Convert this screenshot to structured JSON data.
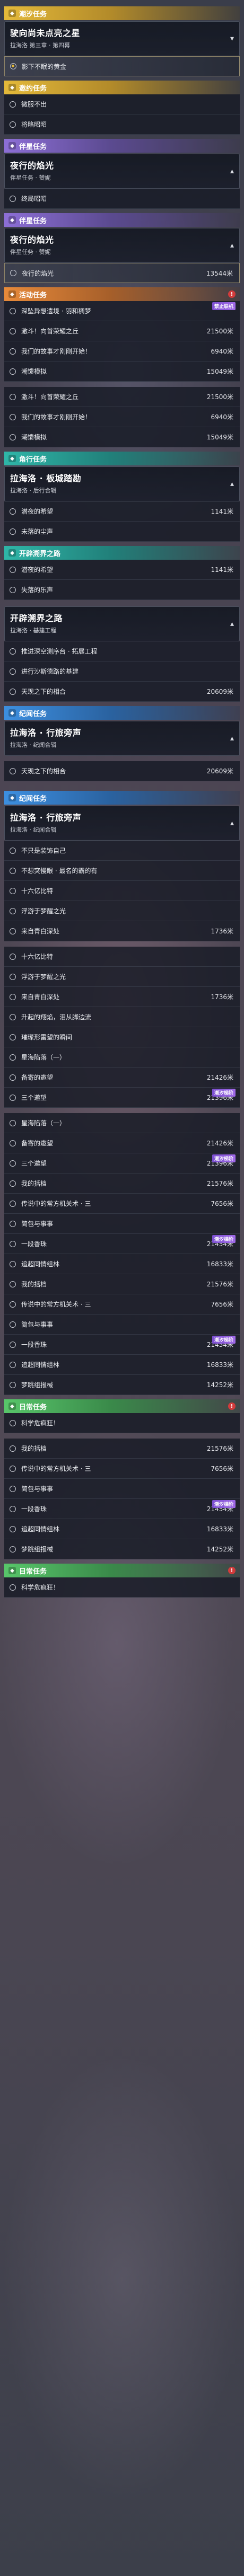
{
  "icons": {
    "bullet": "circle-bullet-icon",
    "expand": "chevron-icon",
    "section": "quest-type-icon",
    "alert": "alert-dot-icon"
  },
  "blocks": [
    {
      "type": "section",
      "color": "yellow",
      "label": "潮汐任务",
      "alert": false
    },
    {
      "type": "card",
      "title": "驶向尚未点亮之星",
      "sub": "拉海洛 第三章 · 第四幕",
      "chev": "▾"
    },
    {
      "type": "row",
      "label": "影下不眠的黄金",
      "selected": true,
      "filled": true
    },
    {
      "type": "section",
      "color": "yellow",
      "label": "邀约任务",
      "alert": false
    },
    {
      "type": "row",
      "label": "微服不出"
    },
    {
      "type": "row",
      "label": "将略昭昭"
    },
    {
      "type": "section",
      "color": "purple",
      "label": "伴星任务",
      "alert": false
    },
    {
      "type": "card",
      "title": "夜行的焰光",
      "sub": "伴星任务 · 赞妮",
      "chev": "▴"
    },
    {
      "type": "row",
      "label": "终局昭昭"
    },
    {
      "type": "section",
      "color": "purple",
      "label": "伴星任务",
      "alert": false
    },
    {
      "type": "card",
      "title": "夜行的焰光",
      "sub": "伴星任务 · 赞妮",
      "chev": "▴"
    },
    {
      "type": "row",
      "label": "夜行的焰光",
      "dist": "13544米",
      "selected": true
    },
    {
      "type": "section",
      "color": "orange",
      "label": "活动任务",
      "alert": true
    },
    {
      "type": "row",
      "label": "深坠异想遗境 · 羽和稠梦",
      "badge": "禁止联机"
    },
    {
      "type": "row",
      "label": "激斗！向首荣耀之丘",
      "dist": "21500米"
    },
    {
      "type": "row",
      "label": "我们的故事才刚刚开始！",
      "dist": "6940米"
    },
    {
      "type": "row",
      "label": "潮馈模拟",
      "dist": "15049米"
    },
    {
      "type": "gap"
    },
    {
      "type": "row",
      "label": "激斗！向首荣耀之丘",
      "dist": "21500米"
    },
    {
      "type": "row",
      "label": "我们的故事才刚刚开始！",
      "dist": "6940米"
    },
    {
      "type": "row",
      "label": "潮馈模拟",
      "dist": "15049米"
    },
    {
      "type": "section",
      "color": "teal",
      "label": "角行任务",
      "alert": false
    },
    {
      "type": "card",
      "title": "拉海洛 · 板城踏勘",
      "sub": "拉海洛 · 后行合辑",
      "chev": "▴"
    },
    {
      "type": "row",
      "label": "潜夜的希望",
      "dist": "1141米"
    },
    {
      "type": "row",
      "label": "未落的尘声"
    },
    {
      "type": "section",
      "color": "teal",
      "label": "开辟溯界之路",
      "alert": false
    },
    {
      "type": "row",
      "label": "潜夜的希望",
      "dist": "1141米"
    },
    {
      "type": "row",
      "label": "失落的乐声"
    },
    {
      "type": "gap"
    },
    {
      "type": "card",
      "title": "开辟溯界之路",
      "sub": "拉海洛 · 基建工程",
      "chev": "▴"
    },
    {
      "type": "row",
      "label": "推进深空测序台 · 拓展工程"
    },
    {
      "type": "row",
      "label": "进行沙斯德路的基建"
    },
    {
      "type": "row",
      "label": "天现之下的相合",
      "dist": "20609米"
    },
    {
      "type": "section",
      "color": "blue",
      "label": "纪闻任务",
      "alert": false
    },
    {
      "type": "card",
      "title": "拉海洛 · 行旅旁声",
      "sub": "拉海洛 · 纪闻合辑",
      "chev": "▴"
    },
    {
      "type": "gap"
    },
    {
      "type": "row",
      "label": "天现之下的相合",
      "dist": "20609米"
    },
    {
      "type": "gap"
    },
    {
      "type": "section",
      "color": "blue",
      "label": "纪闻任务",
      "alert": false
    },
    {
      "type": "card",
      "title": "拉海洛 · 行旅旁声",
      "sub": "拉海洛 · 纪闻合辑",
      "chev": "▴"
    },
    {
      "type": "row",
      "label": "不只是装饰自己"
    },
    {
      "type": "row",
      "label": "不想突慢眼 · 最名的霸的有"
    },
    {
      "type": "row",
      "label": "十六亿比特"
    },
    {
      "type": "row",
      "label": "浮游于梦醒之光"
    },
    {
      "type": "row",
      "label": "来自青白深处",
      "dist": "1736米"
    },
    {
      "type": "gap"
    },
    {
      "type": "row",
      "label": "十六亿比特"
    },
    {
      "type": "row",
      "label": "浮游于梦醒之光"
    },
    {
      "type": "row",
      "label": "来自青白深处",
      "dist": "1736米"
    },
    {
      "type": "row",
      "label": "升起的翔焰，泪从脚边流"
    },
    {
      "type": "row",
      "label": "璀璨形雷望的瞬间"
    },
    {
      "type": "row",
      "label": "星海陷落（一）"
    },
    {
      "type": "row",
      "label": "备寄的邀望",
      "dist": "21426米"
    },
    {
      "type": "row",
      "label": "三个邀望",
      "dist": "21396米",
      "badge": "潮汐梯阶"
    },
    {
      "type": "gap"
    },
    {
      "type": "row",
      "label": "星海陷落（一）"
    },
    {
      "type": "row",
      "label": "备寄的邀望",
      "dist": "21426米"
    },
    {
      "type": "row",
      "label": "三个邀望",
      "dist": "21396米",
      "badge": "潮汐梯阶"
    },
    {
      "type": "row",
      "label": "我的括档",
      "dist": "21576米"
    },
    {
      "type": "row",
      "label": "传说中的常方机关术 · 三",
      "dist": "7656米"
    },
    {
      "type": "row",
      "label": "简包与事事"
    },
    {
      "type": "row",
      "label": "一段香珠",
      "dist": "21454米",
      "badge": "潮汐梯阶"
    },
    {
      "type": "row",
      "label": "追超同情组林",
      "dist": "16833米"
    },
    {
      "type": "row",
      "label": "我的括档",
      "dist": "21576米"
    },
    {
      "type": "row",
      "label": "传说中的常方机关术 · 三",
      "dist": "7656米"
    },
    {
      "type": "row",
      "label": "简包与事事"
    },
    {
      "type": "row",
      "label": "一段香珠",
      "dist": "21454米",
      "badge": "潮汐梯阶"
    },
    {
      "type": "row",
      "label": "追超同情组林",
      "dist": "16833米"
    },
    {
      "type": "row",
      "label": "梦跳组报械",
      "dist": "14252米"
    },
    {
      "type": "section",
      "color": "green",
      "label": "日常任务",
      "alert": true
    },
    {
      "type": "row",
      "label": "科学危疯狂！"
    },
    {
      "type": "gap"
    },
    {
      "type": "row",
      "label": "我的括档",
      "dist": "21576米"
    },
    {
      "type": "row",
      "label": "传说中的常方机关术 · 三",
      "dist": "7656米"
    },
    {
      "type": "row",
      "label": "简包与事事"
    },
    {
      "type": "row",
      "label": "一段香珠",
      "dist": "21454米",
      "badge": "潮汐梯阶"
    },
    {
      "type": "row",
      "label": "追超同情组林",
      "dist": "16833米"
    },
    {
      "type": "row",
      "label": "梦跳组报械",
      "dist": "14252米"
    },
    {
      "type": "section",
      "color": "green",
      "label": "日常任务",
      "alert": true
    },
    {
      "type": "row",
      "label": "科学危疯狂！"
    }
  ]
}
